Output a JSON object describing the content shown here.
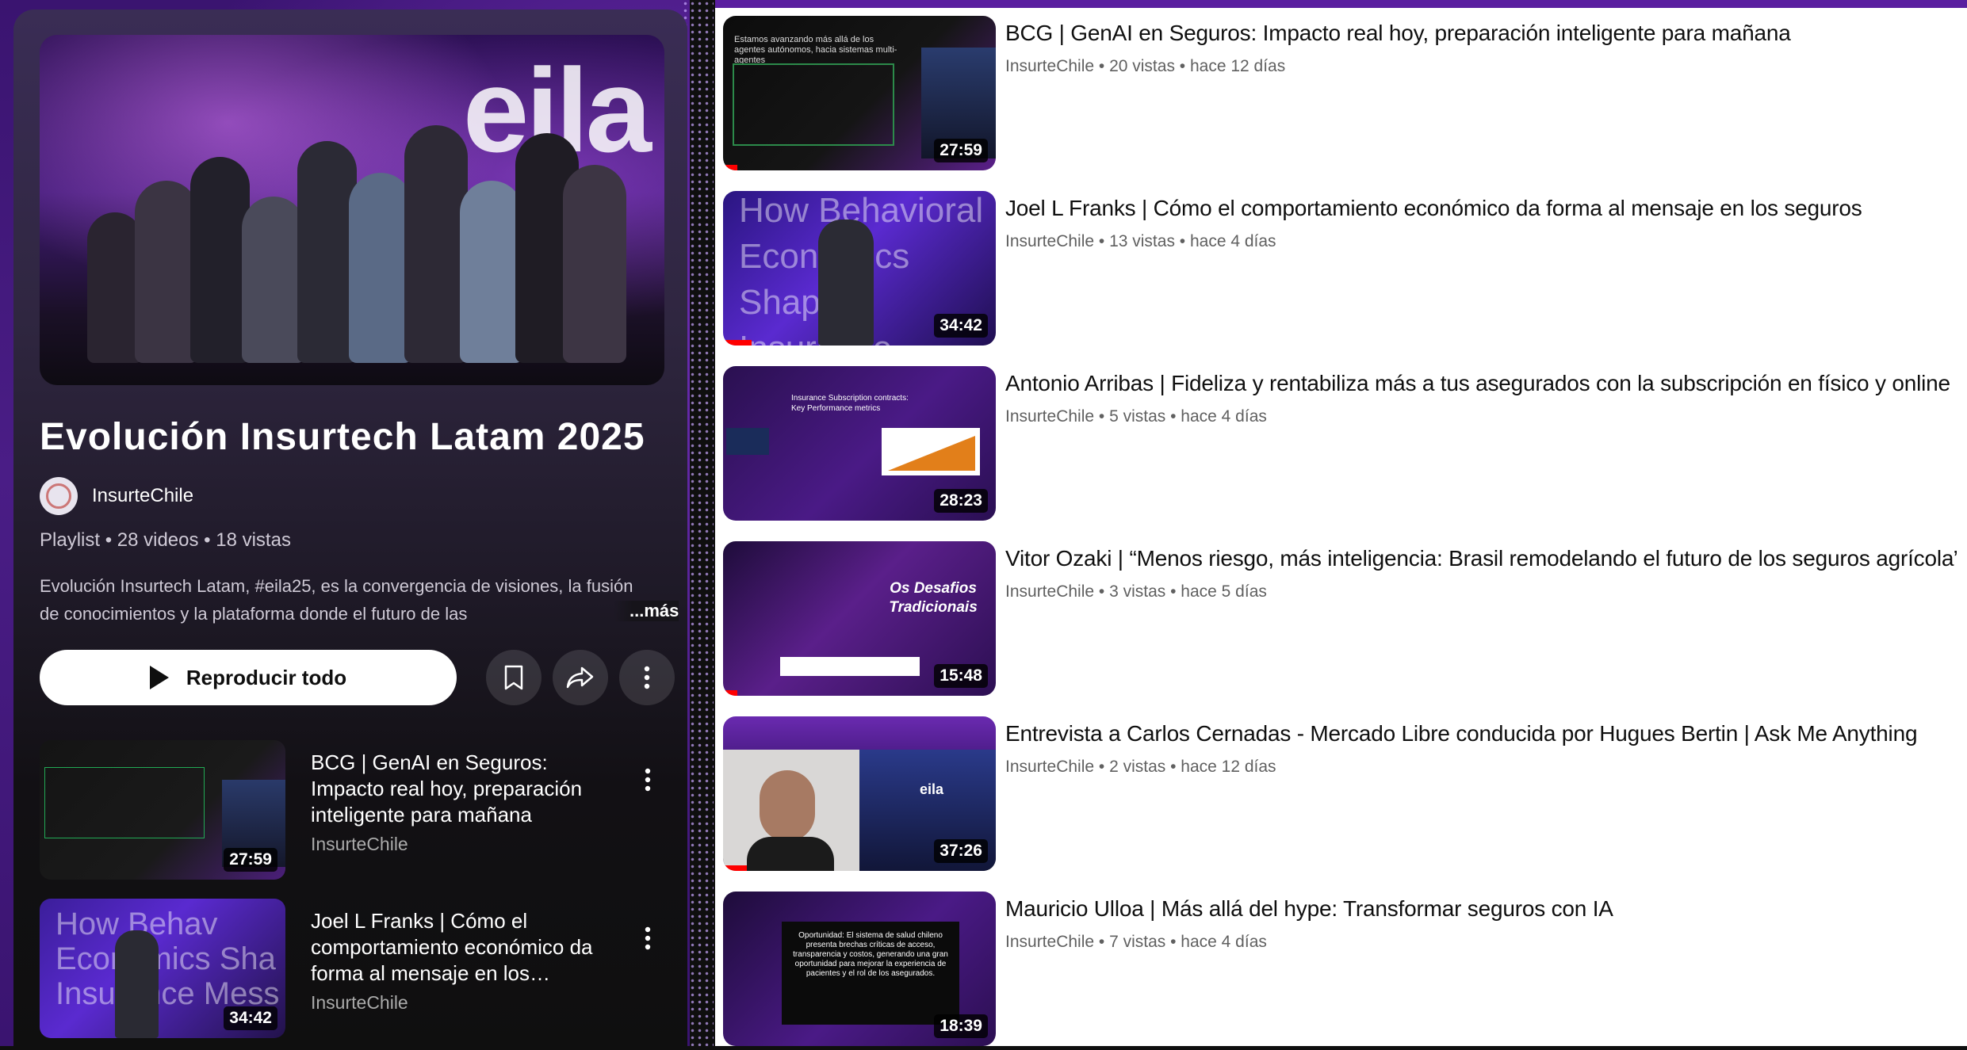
{
  "playlist": {
    "title": "Evolución Insurtech Latam 2025",
    "hero_logo": "eila",
    "channel": "InsurteChile",
    "meta": "Playlist • 28 videos • 18 vistas",
    "description": "Evolución Insurtech Latam, #eila25, es la convergencia de visiones, la fusión de conocimientos y la plataforma donde el futuro de las",
    "more_label": "...más",
    "play_all_label": "Reproducir todo",
    "actions": [
      "bookmark-icon",
      "share-icon",
      "more-vert-icon"
    ]
  },
  "mini_items": [
    {
      "title": "BCG | GenAI en Seguros: Impacto real hoy, preparación inteligente para mañana",
      "channel": "InsurteChile",
      "duration": "27:59"
    },
    {
      "title": "Joel L Franks | Cómo el comportamiento económico da forma al mensaje en los seguros",
      "channel": "InsurteChile",
      "duration": "34:42"
    }
  ],
  "videos": [
    {
      "title": "BCG | GenAI en Seguros: Impacto real hoy, preparación inteligente para mañana",
      "meta": "InsurteChile • 20 vistas • hace 12 días",
      "duration": "27:59",
      "slide_text": "Estamos avanzando más allá de los agentes autónomos, hacia sistemas multi-agentes"
    },
    {
      "title": "Joel L Franks | Cómo el comportamiento económico da forma al mensaje en los seguros",
      "meta": "InsurteChile • 13 vistas • hace 4 días",
      "duration": "34:42",
      "slide_text": "How Behavioral Economics Shapes Insurance Messaging"
    },
    {
      "title": "Antonio Arribas | Fideliza y rentabiliza más a tus asegurados con la subscripción en físico y online",
      "meta": "InsurteChile • 5 vistas • hace 4 días",
      "duration": "28:23",
      "slide_text": "Insurance Subscription contracts: Key Performance metrics"
    },
    {
      "title": "Vitor Ozaki | “Menos riesgo, más inteligencia: Brasil remodelando el futuro de los seguros agrícola”",
      "meta": "InsurteChile • 3 vistas • hace 5 días",
      "duration": "15:48",
      "slide_text": "Os Desafios Tradicionais"
    },
    {
      "title": "Entrevista a Carlos Cernadas - Mercado Libre conducida por Hugues Bertin | Ask Me Anything",
      "meta": "InsurteChile • 2 vistas • hace 12 días",
      "duration": "37:26",
      "slide_text": "eila"
    },
    {
      "title": "Mauricio Ulloa | Más allá del hype: Transformar seguros con IA",
      "meta": "InsurteChile • 7 vistas • hace 4 días",
      "duration": "18:39",
      "slide_text": "Oportunidad: El sistema de salud chileno presenta brechas críticas de acceso, transparencia y costos, generando una gran oportunidad para mejorar la experiencia de pacientes y el rol de los asegurados."
    }
  ],
  "colors": {
    "accent": "#ff0000",
    "brand_purple": "#5a1fa0"
  }
}
